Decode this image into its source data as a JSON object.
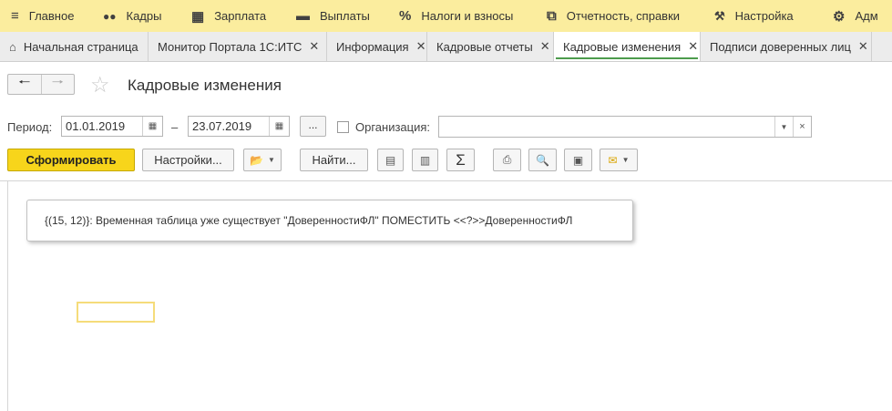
{
  "topmenu": {
    "items": [
      {
        "icon": "≡",
        "label": "Главное"
      },
      {
        "icon": "👥",
        "label": "Кадры"
      },
      {
        "icon": "▦",
        "label": "Зарплата"
      },
      {
        "icon": "▬",
        "label": "Выплаты"
      },
      {
        "icon": "%",
        "label": "Налоги и взносы"
      },
      {
        "icon": "⧉",
        "label": "Отчетность, справки"
      },
      {
        "icon": "🔧",
        "label": "Настройка"
      },
      {
        "icon": "⚙",
        "label": "Адм"
      }
    ]
  },
  "tabs": [
    {
      "label": "Начальная страница",
      "home": true
    },
    {
      "label": "Монитор Портала 1С:ИТС"
    },
    {
      "label": "Информация"
    },
    {
      "label": "Кадровые отчеты"
    },
    {
      "label": "Кадровые изменения",
      "active": true
    },
    {
      "label": "Подписи доверенных лиц"
    }
  ],
  "title": "Кадровые изменения",
  "period": {
    "label": "Период:",
    "from": "01.01.2019",
    "dash": "–",
    "to": "23.07.2019",
    "more": "..."
  },
  "organization": {
    "label": "Организация:",
    "value": ""
  },
  "toolbar": {
    "generate": "Сформировать",
    "settings": "Настройки...",
    "find": "Найти..."
  },
  "message": "{(15, 12)}: Временная таблица уже существует \"ДоверенностиФЛ\" ПОМЕСТИТЬ <<?>>ДоверенностиФЛ",
  "colors": {
    "menu_bg": "#fbed9e",
    "accent_yellow": "#f7d51b",
    "active_tab_line": "#4d9c4d"
  }
}
